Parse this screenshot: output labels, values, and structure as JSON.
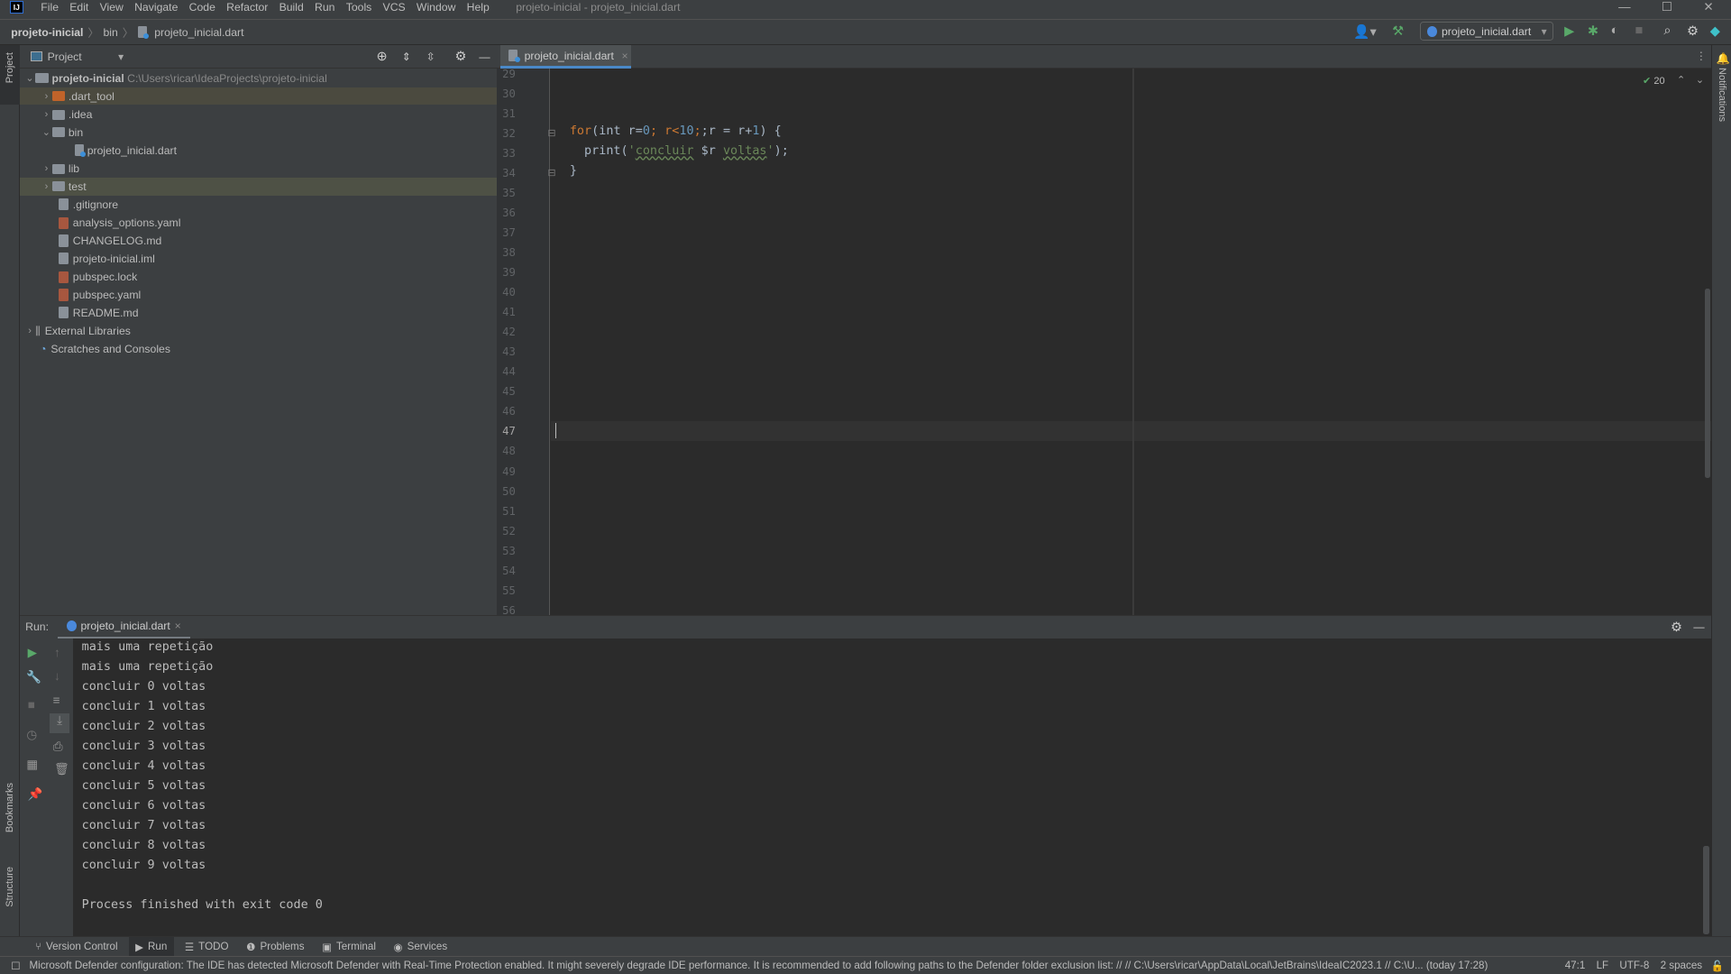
{
  "menu": {
    "logo": "IJ",
    "items": [
      "File",
      "Edit",
      "View",
      "Navigate",
      "Code",
      "Refactor",
      "Build",
      "Run",
      "Tools",
      "VCS",
      "Window",
      "Help"
    ],
    "window_title": "projeto-inicial - projeto_inicial.dart"
  },
  "breadcrumb": [
    "projeto-inicial",
    "bin",
    "projeto_inicial.dart"
  ],
  "toolbar": {
    "run_config": "projeto_inicial.dart"
  },
  "project": {
    "title": "Project",
    "root_name": "projeto-inicial",
    "root_path": "C:\\Users\\ricar\\IdeaProjects\\projeto-inicial",
    "items": [
      ".dart_tool",
      ".idea",
      "bin",
      "projeto_inicial.dart",
      "lib",
      "test",
      ".gitignore",
      "analysis_options.yaml",
      "CHANGELOG.md",
      "projeto-inicial.iml",
      "pubspec.lock",
      "pubspec.yaml",
      "README.md",
      "External Libraries",
      "Scratches and Consoles"
    ]
  },
  "left_stripe": {
    "project": "Project",
    "bookmarks": "Bookmarks",
    "structure": "Structure"
  },
  "right_stripe": {
    "notifications": "Notifications"
  },
  "editor": {
    "tab": "projeto_inicial.dart",
    "inspection_count": "20",
    "line_numbers": [
      "29",
      "30",
      "31",
      "32",
      "33",
      "34",
      "35",
      "36",
      "37",
      "38",
      "39",
      "40",
      "41",
      "42",
      "43",
      "44",
      "45",
      "46",
      "47",
      "48",
      "49",
      "50",
      "51",
      "52",
      "53",
      "54",
      "55",
      "56"
    ],
    "current_line": "47",
    "code": {
      "l32_kw": "for",
      "l32_a": "(int r=",
      "l32_n0": "0",
      "l32_b": "; r<",
      "l32_n10": "10",
      "l32_c": ";r = r+",
      "l32_n1": "1",
      "l32_d": ") {",
      "l33_a": "  print(",
      "l33_q": "'",
      "l33_w1": "concluir",
      "l33_s": " $r ",
      "l33_w2": "voltas",
      "l33_q2": "'",
      "l33_b": ");",
      "l34": "}"
    }
  },
  "run": {
    "label": "Run:",
    "tab": "projeto_inicial.dart",
    "output": [
      "mais uma repetição",
      "mais uma repetição",
      "concluir 0 voltas",
      "concluir 1 voltas",
      "concluir 2 voltas",
      "concluir 3 voltas",
      "concluir 4 voltas",
      "concluir 5 voltas",
      "concluir 6 voltas",
      "concluir 7 voltas",
      "concluir 8 voltas",
      "concluir 9 voltas",
      "",
      "Process finished with exit code 0"
    ]
  },
  "bottom_tools": [
    "Version Control",
    "Run",
    "TODO",
    "Problems",
    "Terminal",
    "Services"
  ],
  "status": {
    "message": "Microsoft Defender configuration: The IDE has detected Microsoft Defender with Real-Time Protection enabled. It might severely degrade IDE performance. It is recommended to add following paths to the Defender folder exclusion list: // //  C:\\Users\\ricar\\AppData\\Local\\JetBrains\\IdeaIC2023.1 //  C:\\U... (today 17:28)",
    "position": "47:1",
    "line_sep": "LF",
    "encoding": "UTF-8",
    "indent": "2 spaces"
  }
}
